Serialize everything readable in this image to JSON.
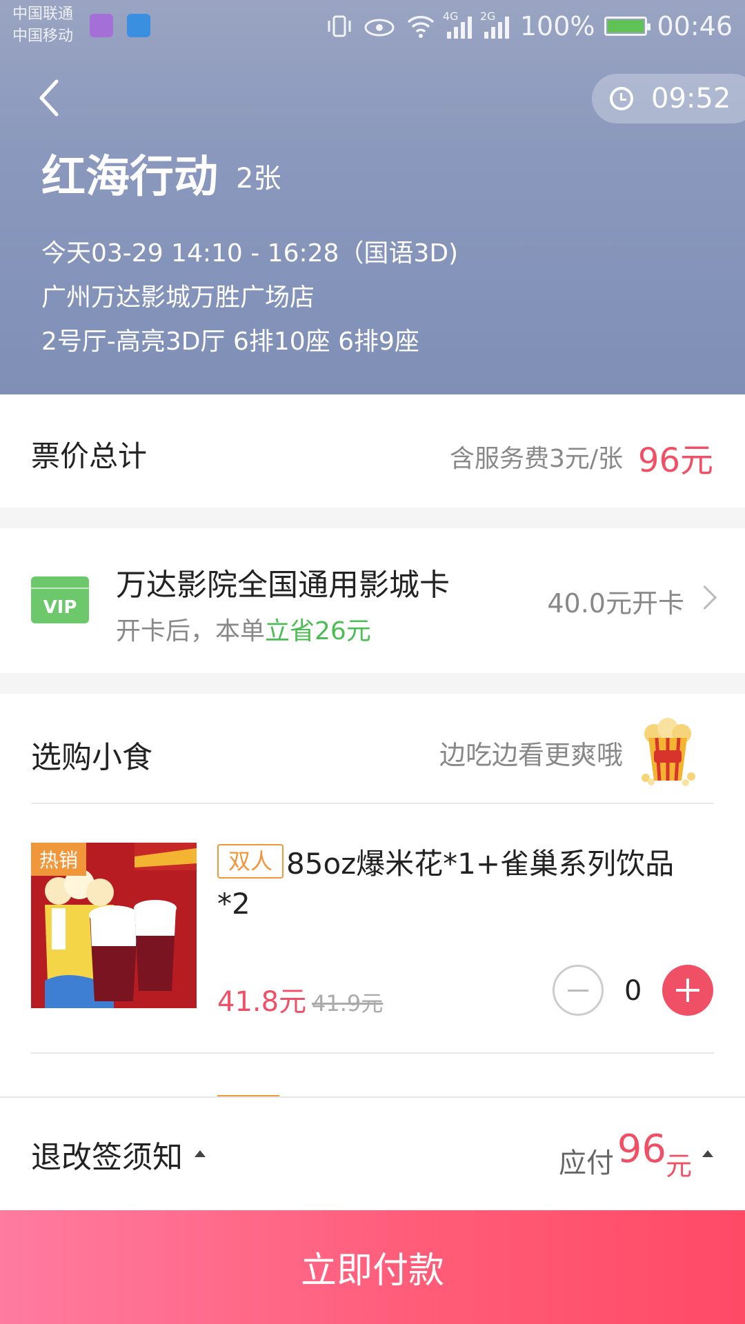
{
  "status_bar": {
    "carrier1": "中国联通",
    "carrier2": "中国移动",
    "net1": "4G",
    "net2": "2G",
    "battery": "100%",
    "time": "00:46"
  },
  "header": {
    "countdown": "09:52",
    "movie_title": "红海行动",
    "ticket_count": "2张",
    "showtime": "今天03-29 14:10 - 16:28（国语3D)",
    "cinema": "广州万达影城万胜广场店",
    "hall_seats": "2号厅-高亮3D厅 6排10座 6排9座"
  },
  "ticket_price": {
    "label": "票价总计",
    "service_fee": "含服务费3元/张",
    "total": "96元"
  },
  "vip_card": {
    "badge": "VIP",
    "title": "万达影院全国通用影城卡",
    "sub_prefix": "开卡后，本单",
    "sub_saving": "立省26元",
    "open_text": "40.0元开卡"
  },
  "snacks": {
    "title": "选购小食",
    "slogan": "边吃边看更爽哦",
    "items": [
      {
        "hot_tag": "热销",
        "combo_tag": "双人",
        "name": "85oz爆米花*1+雀巢系列饮品*2",
        "price": "41.8元",
        "original_price": "41.9元",
        "quantity": "0"
      }
    ]
  },
  "bottom": {
    "refund_notice": "退改签须知",
    "pay_label": "应付",
    "pay_amount": "96",
    "pay_unit": "元",
    "pay_button": "立即付款"
  },
  "colors": {
    "accent_red": "#f05066",
    "vip_green": "#6cc86b",
    "hot_orange": "#f1973b"
  }
}
